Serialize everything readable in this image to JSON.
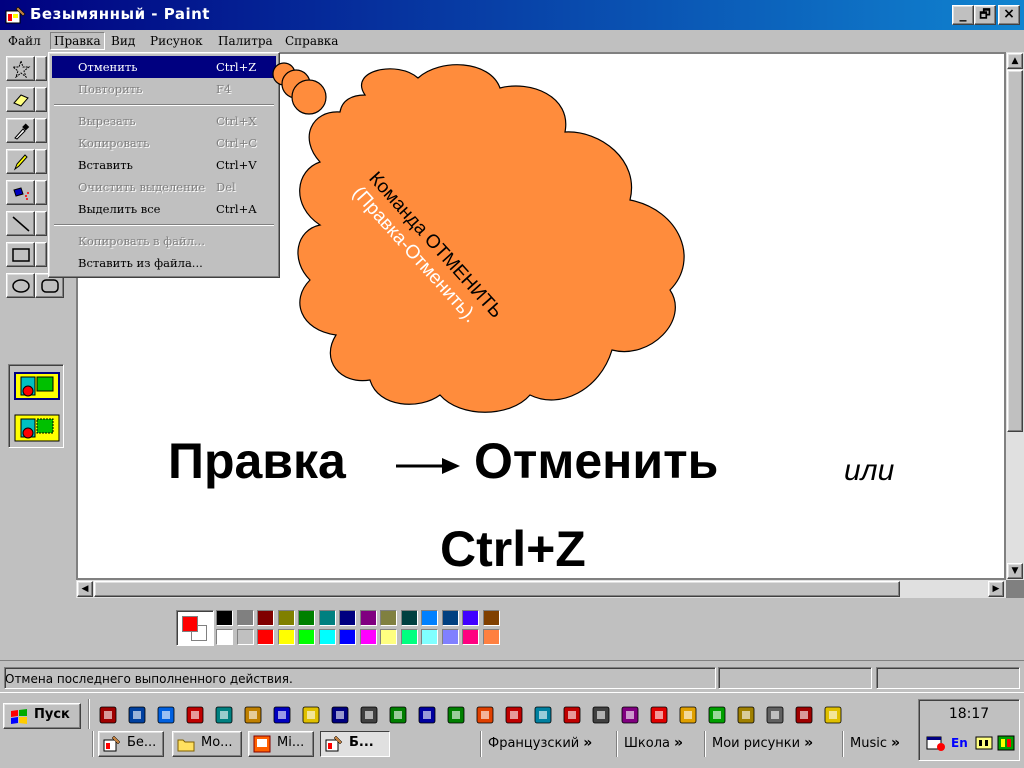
{
  "window": {
    "title": "Безымянный - Paint",
    "minimize": "_",
    "maximize": "🗗",
    "close": "×"
  },
  "menu": [
    {
      "label": "Файл"
    },
    {
      "label": "Правка"
    },
    {
      "label": "Вид"
    },
    {
      "label": "Рисунок"
    },
    {
      "label": "Палитра"
    },
    {
      "label": "Справка"
    }
  ],
  "edit_menu": {
    "items": [
      {
        "label": "Отменить",
        "shortcut": "Ctrl+Z"
      },
      {
        "label": "Повторить",
        "shortcut": "F4"
      },
      {
        "label": "Вырезать",
        "shortcut": "Ctrl+X"
      },
      {
        "label": "Копировать",
        "shortcut": "Ctrl+C"
      },
      {
        "label": "Вставить",
        "shortcut": "Ctrl+V"
      },
      {
        "label": "Очистить выделение",
        "shortcut": "Del"
      },
      {
        "label": "Выделить все",
        "shortcut": "Ctrl+A"
      },
      {
        "label": "Копировать в файл...",
        "shortcut": ""
      },
      {
        "label": "Вставить из файла...",
        "shortcut": ""
      }
    ]
  },
  "callout": {
    "line1": "Команда ОТМЕНИТЬ",
    "line2": "(Правка-Отменить).",
    "fill": "#ff8c3c"
  },
  "caption": {
    "part1": "Правка",
    "part2": "Отменить",
    "or": "или",
    "shortcut": "Ctrl+Z"
  },
  "palette": {
    "foreground": "#ff0000",
    "background": "#ffffff",
    "row1": [
      "#000000",
      "#808080",
      "#800000",
      "#808000",
      "#008000",
      "#008080",
      "#000080",
      "#800080",
      "#808040",
      "#004040",
      "#0080ff",
      "#004080",
      "#4000ff",
      "#804000"
    ],
    "row2": [
      "#ffffff",
      "#c0c0c0",
      "#ff0000",
      "#ffff00",
      "#00ff00",
      "#00ffff",
      "#0000ff",
      "#ff00ff",
      "#ffff80",
      "#00ff80",
      "#80ffff",
      "#8080ff",
      "#ff0080",
      "#ff8040"
    ]
  },
  "status": {
    "text": "Отмена последнего выполненного действия."
  },
  "taskbar": {
    "start": "Пуск",
    "tasks": [
      {
        "label": "Бе..."
      },
      {
        "label": "Мо..."
      },
      {
        "label": "Mi..."
      },
      {
        "label": "Б..."
      }
    ],
    "folders": [
      {
        "label": "Французский"
      },
      {
        "label": "Школа"
      },
      {
        "label": "Мои рисунки"
      },
      {
        "label": "Music"
      }
    ],
    "chevron": "»",
    "clock": "18:17",
    "lang": "En"
  }
}
